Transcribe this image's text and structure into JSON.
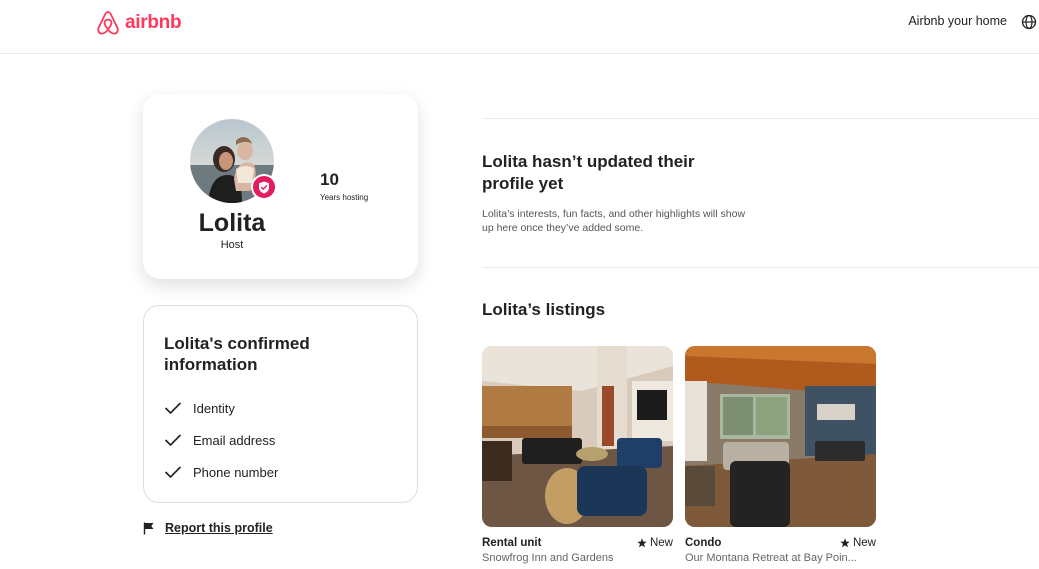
{
  "header": {
    "logo_text": "airbnb",
    "host_link": "Airbnb your home",
    "brand_color": "#ff385c"
  },
  "profile": {
    "name": "Lolita",
    "role": "Host",
    "stat_value": "10",
    "stat_label": "Years hosting"
  },
  "confirmed": {
    "title": "Lolita's confirmed information",
    "items": [
      "Identity",
      "Email address",
      "Phone number"
    ]
  },
  "report": {
    "label": "Report this profile"
  },
  "about": {
    "title": "Lolita hasn’t updated their profile yet",
    "text": "Lolita’s interests, fun facts, and other highlights will show up here once they’ve added some."
  },
  "listings": {
    "title": "Lolita’s listings",
    "items": [
      {
        "type": "Rental unit",
        "rating": "New",
        "name": "Snowfrog Inn and Gardens"
      },
      {
        "type": "Condo",
        "rating": "New",
        "name": "Our Montana Retreat at Bay Poin..."
      }
    ]
  }
}
